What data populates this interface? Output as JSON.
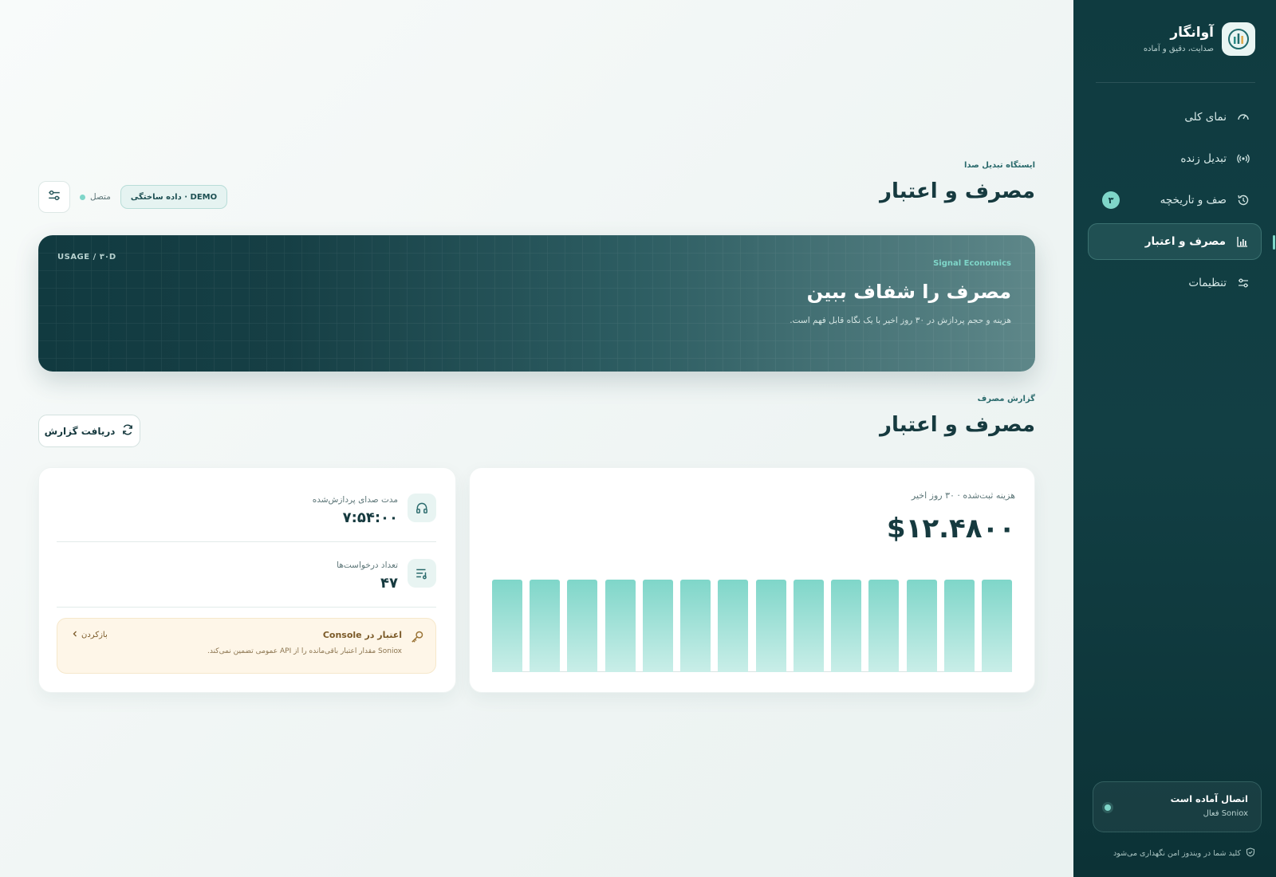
{
  "brand": {
    "title": "آوانگار",
    "subtitle": "صدایت، دقیق و آماده"
  },
  "sidebar": {
    "items": [
      {
        "label": "نمای کلی",
        "icon": "gauge-icon"
      },
      {
        "label": "تبدیل زنده",
        "icon": "broadcast-icon"
      },
      {
        "label": "صف و تاریخچه",
        "icon": "history-icon",
        "badge": "۳"
      },
      {
        "label": "مصرف و اعتبار",
        "icon": "bar-chart-icon",
        "active": true
      },
      {
        "label": "تنظیمات",
        "icon": "sliders-icon"
      }
    ],
    "status": {
      "title": "اتصال آماده است",
      "subtitle": "Soniox فعال"
    },
    "footer": "کلید شما در ویندوز امن نگهداری می‌شود"
  },
  "header": {
    "eyebrow": "ایستگاه تبدیل صدا",
    "title": "مصرف و اعتبار",
    "connection": "متصل",
    "demo": "DEMO · داده ساختگی"
  },
  "hero": {
    "tag": "USAGE / ۳۰D",
    "eyebrow": "Signal Economics",
    "title": "مصرف را شفاف ببین",
    "subtitle": "هزینه و حجم پردازش در ۳۰ روز اخیر با یک نگاه قابل فهم است."
  },
  "report": {
    "eyebrow": "گزارش مصرف",
    "title": "مصرف و اعتبار",
    "button": "دریافت گزارش"
  },
  "cost": {
    "label": "هزینه ثبت‌شده · ۳۰ روز اخیر",
    "value": "$۱۲.۴۸۰۰"
  },
  "chart_data": {
    "type": "bar",
    "values": [
      1,
      1,
      1,
      1,
      1,
      1,
      1,
      1,
      1,
      1,
      1,
      1,
      1,
      1
    ]
  },
  "stats": {
    "duration": {
      "label": "مدت صدای پردازش‌شده",
      "value": "۷:۵۴:۰۰"
    },
    "requests": {
      "label": "تعداد درخواست‌ها",
      "value": "۴۷"
    }
  },
  "credit": {
    "title": "اعتبار در Console",
    "subtitle": "Soniox مقدار اعتبار باقی‌مانده را از API عمومی تضمین نمی‌کند.",
    "link": "بازکردن"
  },
  "colors": {
    "accent": "#7fd6c9",
    "sidebar": "#0f3b40",
    "warning_bg": "#fef6e8"
  }
}
